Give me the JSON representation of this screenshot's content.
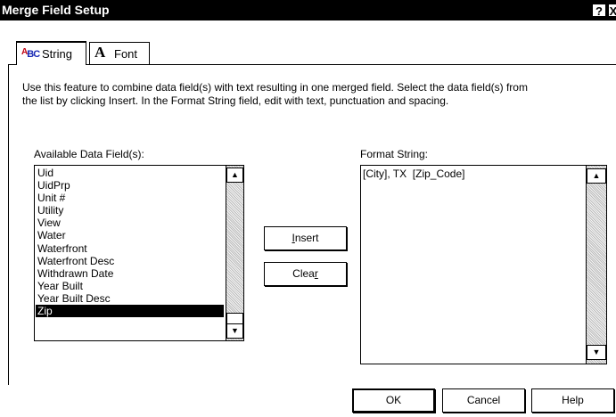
{
  "window": {
    "title": "Merge Field Setup",
    "help_glyph": "?",
    "close_glyph": "X"
  },
  "tabs": [
    {
      "label": "String",
      "icon": "string-abc-icon",
      "active": true
    },
    {
      "label": "Font",
      "icon": "font-a-icon",
      "active": false
    }
  ],
  "description": {
    "line1": "Use this feature to combine data field(s) with text resulting in one merged field.  Select the data field(s) from",
    "line2": "the list by clicking Insert.  In the Format String field, edit with text, punctuation and spacing."
  },
  "available_fields": {
    "label": "Available Data Field(s):",
    "items": [
      "Uid",
      "UidPrp",
      "Unit #",
      "Utility",
      "View",
      "Water",
      "Waterfront",
      "Waterfront Desc",
      "Withdrawn Date",
      "Year Built",
      "Year Built Desc",
      "Zip"
    ],
    "selected": "Zip"
  },
  "format_string": {
    "label": "Format String:",
    "value": "[City], TX  [Zip_Code]"
  },
  "buttons": {
    "insert_pre": "",
    "insert_u": "I",
    "insert_post": "nsert",
    "clear_pre": "Clea",
    "clear_u": "r",
    "clear_post": "",
    "ok": "OK",
    "cancel": "Cancel",
    "help": "Help"
  },
  "icons": {
    "scroll_up": "▲",
    "scroll_down": "▼",
    "tab_string_glyph_a": "A",
    "tab_string_glyph_b": "B",
    "tab_string_glyph_c": "C",
    "tab_font_glyph": "A"
  }
}
